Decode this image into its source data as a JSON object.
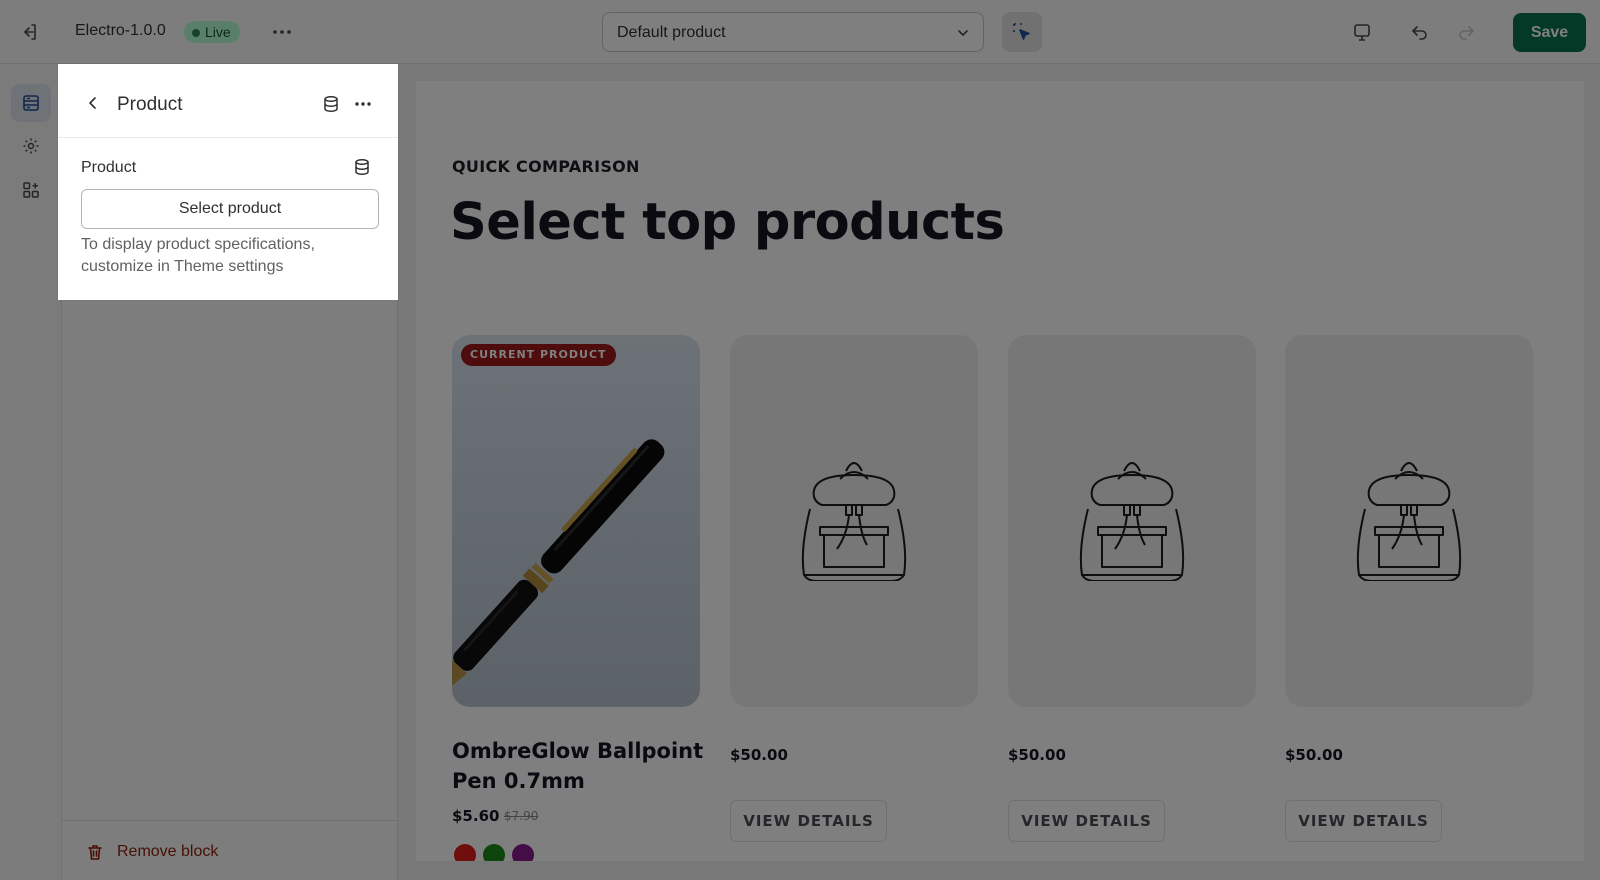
{
  "topbar": {
    "theme_name": "Electro-1.0.0",
    "live_label": "Live",
    "template_select_value": "Default product",
    "save_label": "Save"
  },
  "panel": {
    "title": "Product",
    "field_label": "Product",
    "select_button_label": "Select product",
    "help_text": "To display product specifications, customize in Theme settings",
    "remove_label": "Remove block"
  },
  "preview": {
    "kicker": "QUICK COMPARISON",
    "heading": "Select top products",
    "current_badge": "CURRENT PRODUCT",
    "current_product": {
      "name": "OmbreGlow Ballpoint Pen 0.7mm",
      "price": "$5.60",
      "compare_price": "$7.90",
      "swatches": [
        "#e01b1b",
        "#1a8a1a",
        "#8a1a8a"
      ]
    },
    "placeholder_cards": [
      {
        "price": "$50.00",
        "button": "VIEW DETAILS"
      },
      {
        "price": "$50.00",
        "button": "VIEW DETAILS"
      },
      {
        "price": "$50.00",
        "button": "VIEW DETAILS"
      }
    ]
  },
  "colors": {
    "save": "#08734f",
    "live_badge": "#b4fed2",
    "current_badge": "#9c1818",
    "remove": "#8e1f0b"
  }
}
